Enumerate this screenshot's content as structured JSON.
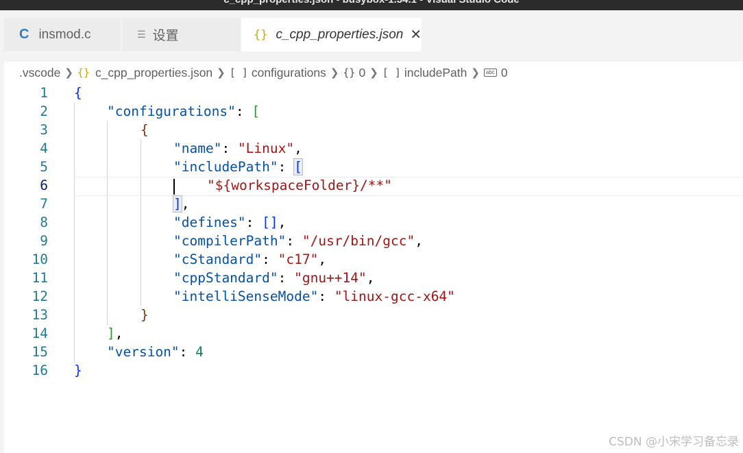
{
  "window": {
    "title": "c_cpp_properties.json - busybox-1.34.1 - Visual Studio Code"
  },
  "tabs": [
    {
      "label": "insmod.c",
      "icon": "c-file-icon"
    },
    {
      "label": "设置",
      "icon": "settings-icon"
    },
    {
      "label": "c_cpp_properties.json",
      "icon": "json-braces-icon",
      "active": true
    }
  ],
  "breadcrumb": [
    {
      "label": ".vscode"
    },
    {
      "label": "c_cpp_properties.json",
      "icon": "{}"
    },
    {
      "label": "configurations",
      "icon": "[ ]"
    },
    {
      "label": "0",
      "icon": "{}"
    },
    {
      "label": "includePath",
      "icon": "[ ]"
    },
    {
      "label": "0",
      "icon": "abc"
    }
  ],
  "editor": {
    "current_line": "6",
    "line_numbers": [
      "1",
      "2",
      "3",
      "4",
      "5",
      "6",
      "7",
      "8",
      "9",
      "10",
      "11",
      "12",
      "13",
      "14",
      "15",
      "16"
    ],
    "tokens": {
      "l1_brace": "{",
      "l2_key": "\"configurations\"",
      "l2_colon": ": ",
      "l2_bracket": "[",
      "l3_brace": "{",
      "l4_key": "\"name\"",
      "l4_colon": ": ",
      "l4_val": "\"Linux\"",
      "l4_comma": ",",
      "l5_key": "\"includePath\"",
      "l5_colon": ": ",
      "l5_bracket": "[",
      "l6_val": "\"${workspaceFolder}/**\"",
      "l7_bracket": "]",
      "l7_comma": ",",
      "l8_key": "\"defines\"",
      "l8_colon": ": ",
      "l8_bracket": "[]",
      "l8_comma": ",",
      "l9_key": "\"compilerPath\"",
      "l9_colon": ": ",
      "l9_val": "\"/usr/bin/gcc\"",
      "l9_comma": ",",
      "l10_key": "\"cStandard\"",
      "l10_colon": ": ",
      "l10_val": "\"c17\"",
      "l10_comma": ",",
      "l11_key": "\"cppStandard\"",
      "l11_colon": ": ",
      "l11_val": "\"gnu++14\"",
      "l11_comma": ",",
      "l12_key": "\"intelliSenseMode\"",
      "l12_colon": ": ",
      "l12_val": "\"linux-gcc-x64\"",
      "l13_brace": "}",
      "l14_bracket": "]",
      "l14_comma": ",",
      "l15_key": "\"version\"",
      "l15_colon": ": ",
      "l15_val": "4",
      "l16_brace": "}"
    }
  },
  "watermark": "CSDN @小宋学习备忘录",
  "colors": {
    "key": "#0451a5",
    "string": "#a31515",
    "number": "#098658",
    "bracket_level1": "#0431fa",
    "bracket_level2": "#319331",
    "bracket_level3": "#7b3814",
    "line_number": "#237893"
  }
}
